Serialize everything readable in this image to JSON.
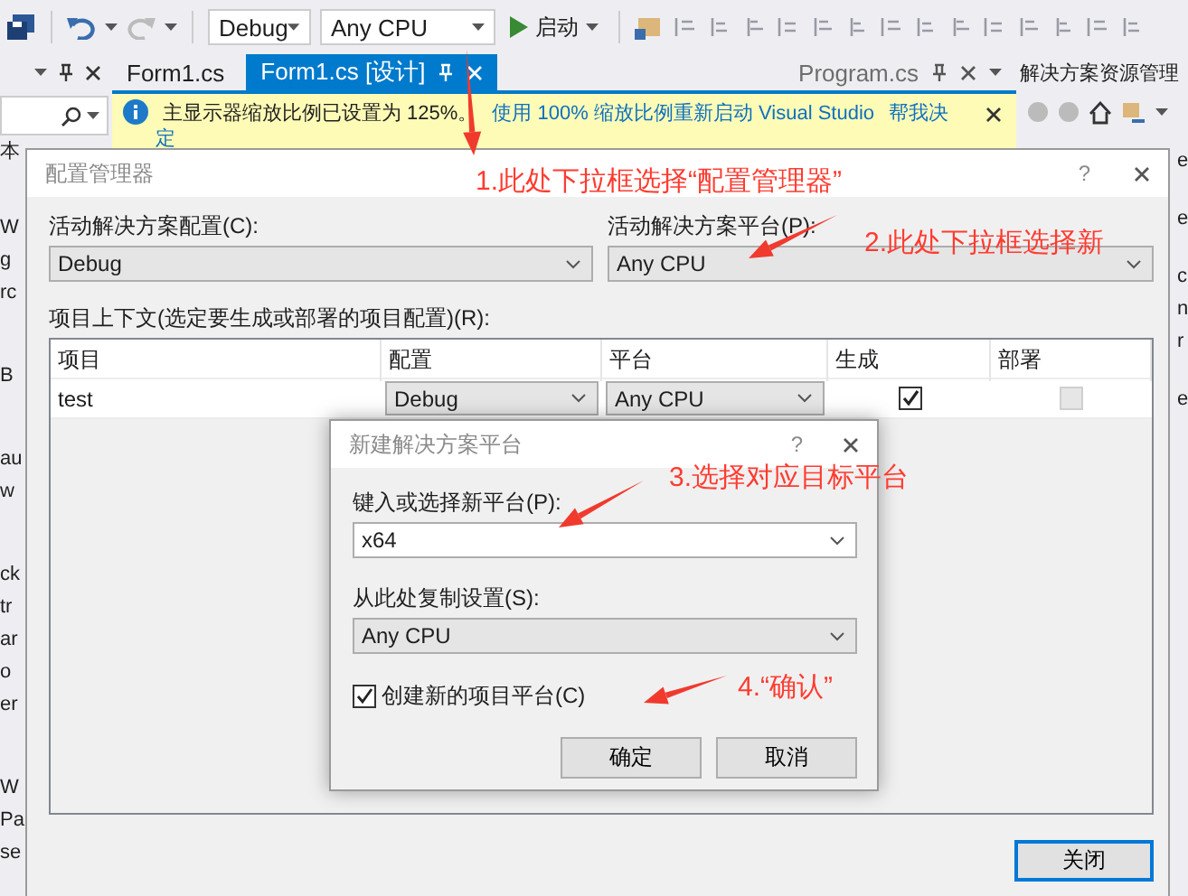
{
  "toolbar": {
    "configuration": "Debug",
    "platform": "Any CPU",
    "start_label": "启动"
  },
  "left_panel": {
    "heading": "本",
    "groups": [
      [
        "W",
        "g",
        "rc"
      ],
      [
        "B"
      ],
      [
        "au",
        "w"
      ],
      [
        "ck",
        "tr",
        "ar",
        "o",
        "er"
      ],
      [
        "W",
        "Pa",
        "se"
      ]
    ]
  },
  "editor": {
    "tabs": [
      {
        "label": "Form1.cs",
        "selected": false
      },
      {
        "label": "Form1.cs [设计]",
        "selected": true
      }
    ],
    "right_tabs": [
      {
        "label": "Program.cs",
        "selected": false
      }
    ]
  },
  "info_bar": {
    "message": "主显示器缩放比例已设置为 125%。",
    "link": "使用 100% 缩放比例重新启动 Visual Studio",
    "help_link": "帮我决",
    "help_link_wrapped": "定"
  },
  "solution_explorer": {
    "title": "解决方案资源管理",
    "items": [
      [
        "e"
      ],
      [
        "e"
      ],
      [
        "c",
        "n",
        "r"
      ],
      [
        "e"
      ]
    ]
  },
  "config_manager": {
    "title": "配置管理器",
    "help_button": "?",
    "active_config_label": "活动解决方案配置(C):",
    "active_config": "Debug",
    "active_platform_label": "活动解决方案平台(P):",
    "active_platform": "Any CPU",
    "context_label": "项目上下文(选定要生成或部署的项目配置)(R):",
    "columns": [
      "项目",
      "配置",
      "平台",
      "生成",
      "部署"
    ],
    "rows": [
      {
        "project": "test",
        "configuration": "Debug",
        "platform": "Any CPU",
        "build": {
          "checked": true,
          "disabled": false
        },
        "deploy": {
          "checked": false,
          "disabled": true
        }
      }
    ],
    "close_button": "关闭"
  },
  "new_platform_dialog": {
    "title": "新建解决方案平台",
    "help_button": "?",
    "platform_label": "键入或选择新平台(P):",
    "platform": "x64",
    "copy_label": "从此处复制设置(S):",
    "copy_from": "Any CPU",
    "create_label": "创建新的项目平台(C)",
    "create_checked": true,
    "ok_button": "确定",
    "cancel_button": "取消"
  },
  "annotations": [
    {
      "text": "1.此处下拉框选择“配置管理器”"
    },
    {
      "text": "2.此处下拉框选择新"
    },
    {
      "text": "3.选择对应目标平台"
    },
    {
      "text": "4.“确认”"
    }
  ]
}
